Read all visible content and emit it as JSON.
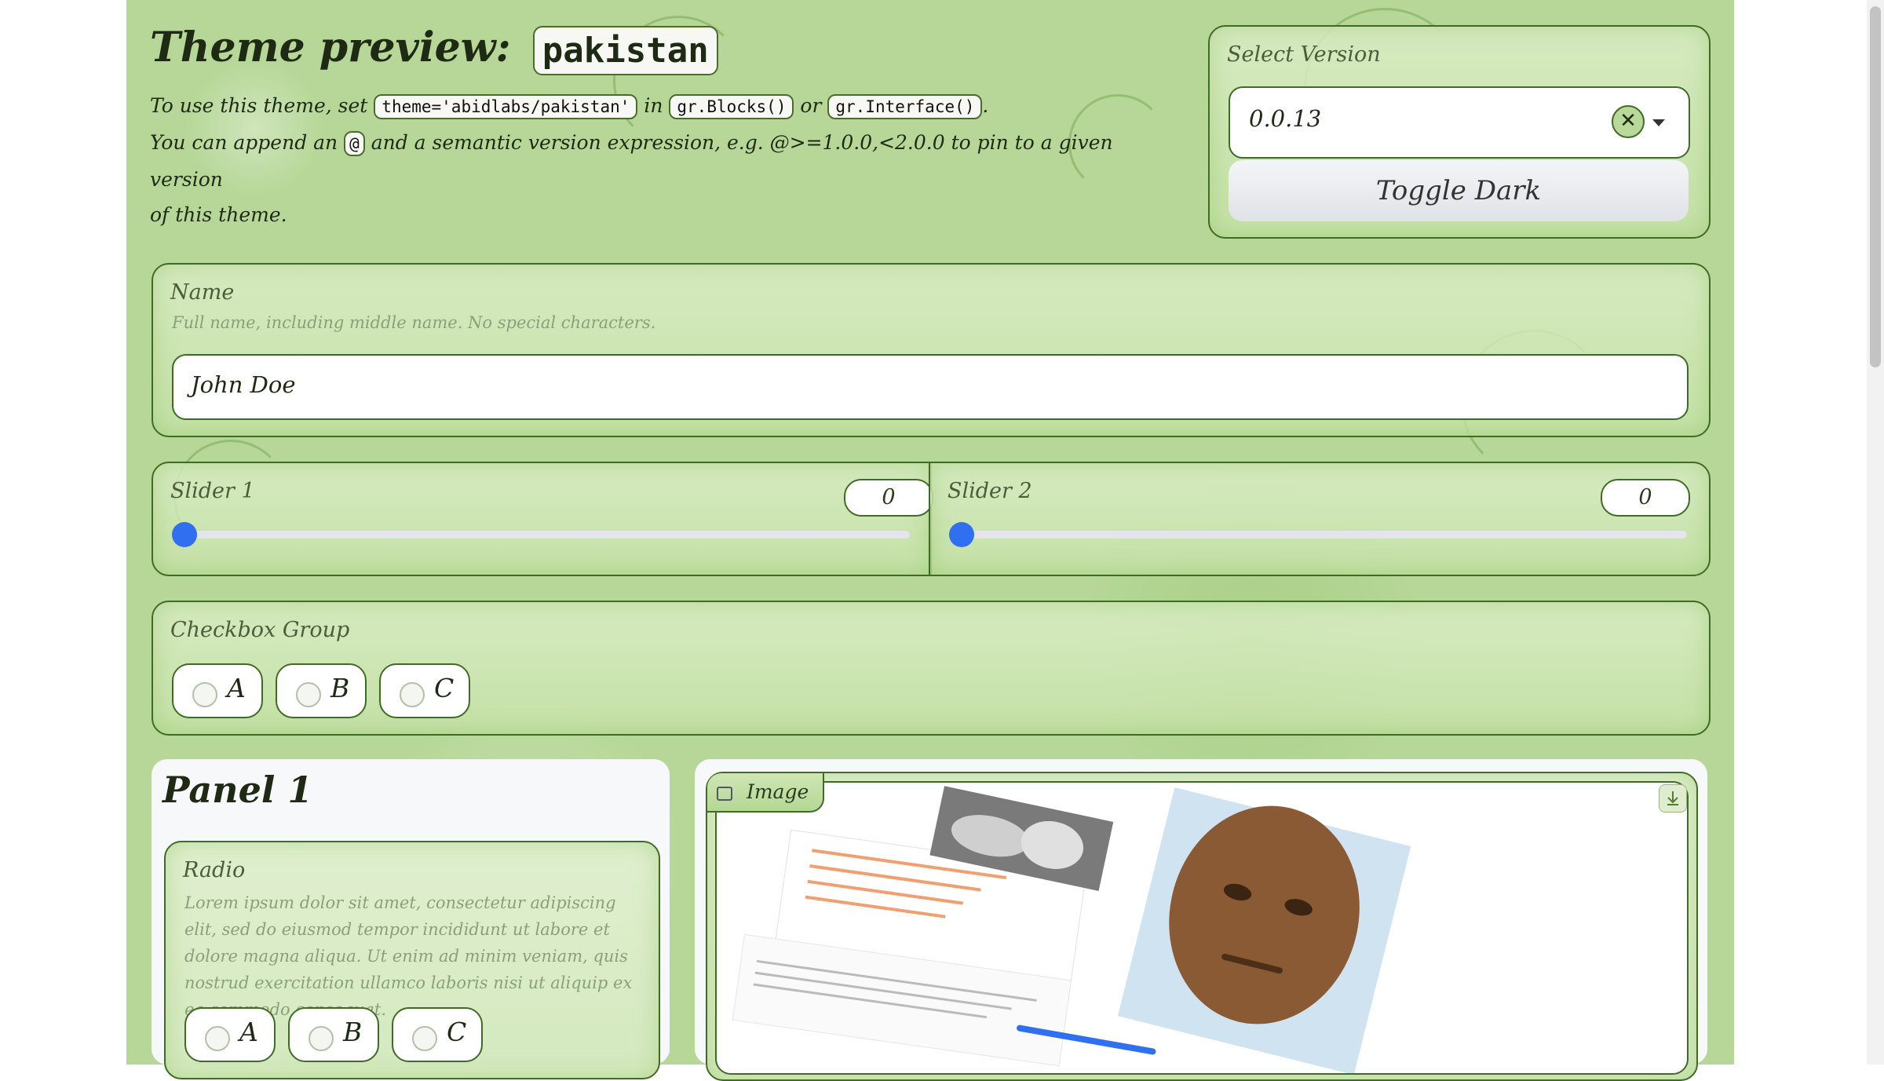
{
  "header": {
    "title_prefix": "Theme preview:",
    "theme_badge": "pakistan",
    "desc_1": "To use this theme, set",
    "code_theme": "theme='abidlabs/pakistan'",
    "desc_in": "in",
    "code_blocks": "gr.Blocks()",
    "desc_or": "or",
    "code_interface": "gr.Interface()",
    "desc_period": ".",
    "desc_2a": "You can append an",
    "code_at": "@",
    "desc_2b": "and a semantic version expression, e.g. @>=1.0.0,<2.0.0 to pin to a given version",
    "desc_3": "of this theme."
  },
  "version": {
    "label": "Select Version",
    "value": "0.0.13",
    "toggle_label": "Toggle Dark"
  },
  "name_field": {
    "label": "Name",
    "info": "Full name, including middle name. No special characters.",
    "value": "John Doe"
  },
  "sliders": [
    {
      "label": "Slider 1",
      "value": "0"
    },
    {
      "label": "Slider 2",
      "value": "0"
    }
  ],
  "checkbox_group": {
    "label": "Checkbox Group",
    "options": [
      "A",
      "B",
      "C"
    ]
  },
  "panel1": {
    "title": "Panel 1",
    "radio_label": "Radio",
    "radio_info": "Lorem ipsum dolor sit amet, consectetur adipiscing elit, sed do eiusmod tempor incididunt ut labore et dolore magna aliqua. Ut enim ad minim veniam, quis nostrud exercitation ullamco laboris nisi ut aliquip ex ea commodo consequat.",
    "radio_options": [
      "A",
      "B",
      "C"
    ]
  },
  "image_block": {
    "label": "Image"
  },
  "colors": {
    "accent": "#2f6ff0",
    "border": "#3f6b25",
    "background": "#b6d797"
  }
}
